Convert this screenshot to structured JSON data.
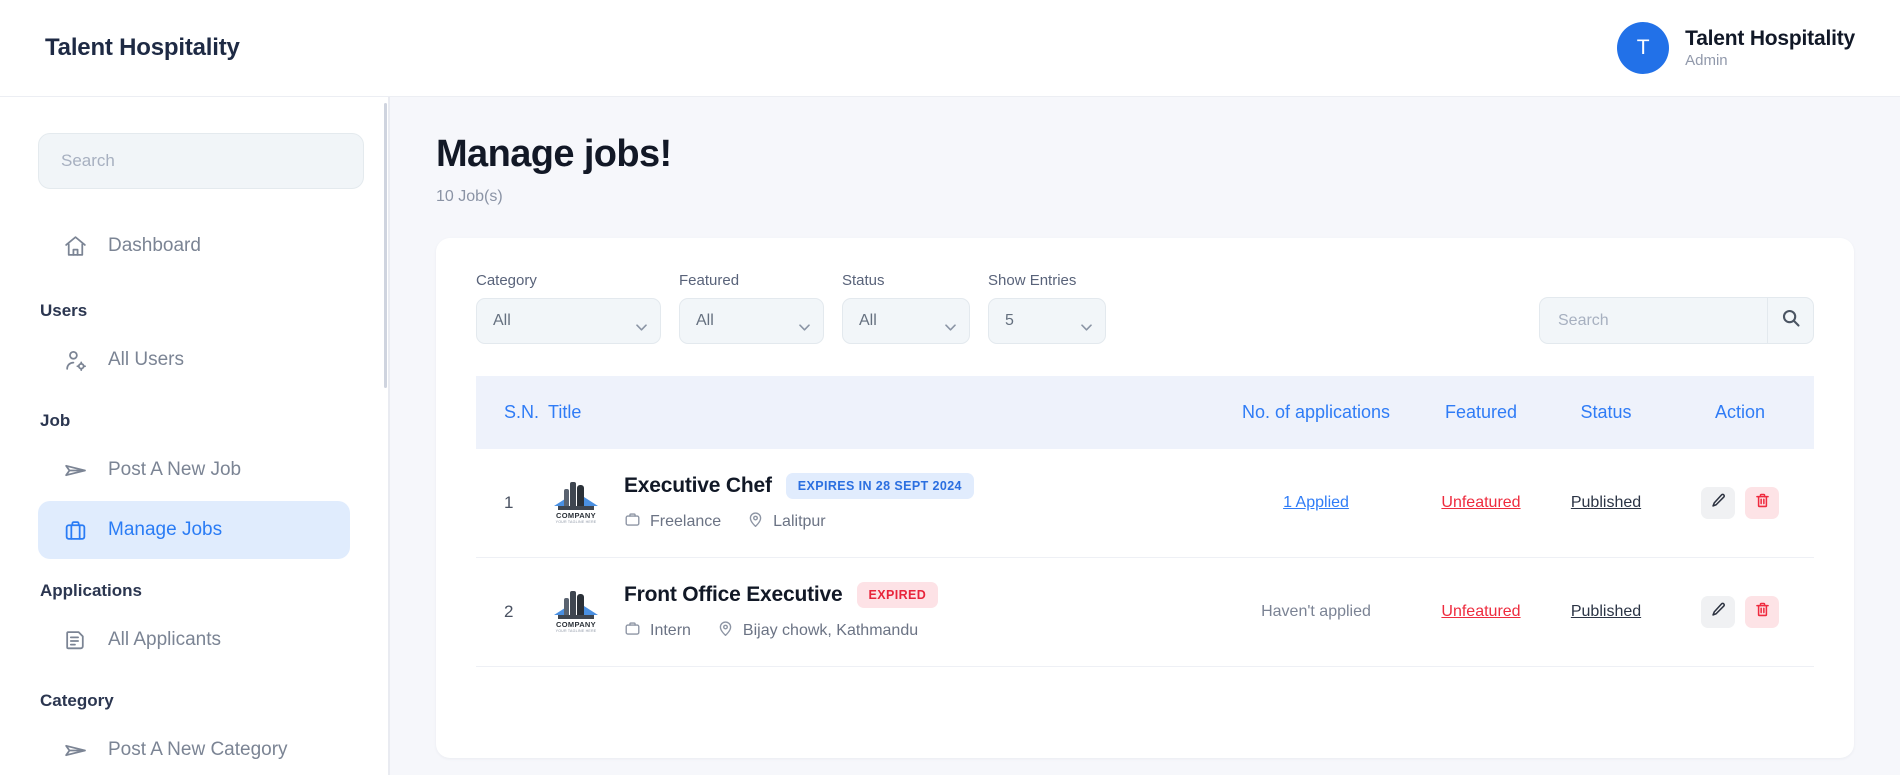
{
  "topbar": {
    "brand": "Talent Hospitality",
    "avatar_initial": "T",
    "user_name": "Talent Hospitality",
    "user_role": "Admin",
    "accent_color": "#2271e8"
  },
  "sidebar": {
    "search_placeholder": "Search",
    "search_value": "",
    "groups": [
      {
        "title": "",
        "items": [
          {
            "label": "Dashboard",
            "icon": "home-icon",
            "active": false
          }
        ]
      },
      {
        "title": "Users",
        "items": [
          {
            "label": "All Users",
            "icon": "user-gear-icon",
            "active": false
          }
        ]
      },
      {
        "title": "Job",
        "items": [
          {
            "label": "Post A New Job",
            "icon": "send-icon",
            "active": false
          },
          {
            "label": "Manage Jobs",
            "icon": "briefcase-icon",
            "active": true
          }
        ]
      },
      {
        "title": "Applications",
        "items": [
          {
            "label": "All Applicants",
            "icon": "document-list-icon",
            "active": false
          }
        ]
      },
      {
        "title": "Category",
        "items": [
          {
            "label": "Post A New Category",
            "icon": "send-icon",
            "active": false
          }
        ]
      }
    ]
  },
  "main": {
    "page_title": "Manage jobs!",
    "page_subtitle": "10 Job(s)",
    "filters": [
      {
        "label": "Category",
        "value": "All"
      },
      {
        "label": "Featured",
        "value": "All"
      },
      {
        "label": "Status",
        "value": "All"
      },
      {
        "label": "Show Entries",
        "value": "5"
      }
    ],
    "table_search_placeholder": "Search",
    "table_search_value": "",
    "table": {
      "headers": {
        "sn": "S.N.",
        "title": "Title",
        "applications": "No. of applications",
        "featured": "Featured",
        "status": "Status",
        "action": "Action"
      },
      "header_color": "#2f7cf6",
      "rows": [
        {
          "sn": "1",
          "company_logo_name": "COMPANY",
          "company_logo_tagline": "YOUR TAGLINE HERE",
          "job_title": "Executive Chef",
          "badge_text": "EXPIRES IN 28 SEPT 2024",
          "badge_type": "blue",
          "job_type": "Freelance",
          "location": "Lalitpur",
          "applications": "1 Applied",
          "applications_is_link": true,
          "featured": "Unfeatured",
          "status": "Published"
        },
        {
          "sn": "2",
          "company_logo_name": "COMPANY",
          "company_logo_tagline": "YOUR TAGLINE HERE",
          "job_title": "Front Office Executive",
          "badge_text": "EXPIRED",
          "badge_type": "red",
          "job_type": "Intern",
          "location": "Bijay chowk, Kathmandu",
          "applications": "Haven't applied",
          "applications_is_link": false,
          "featured": "Unfeatured",
          "status": "Published"
        }
      ]
    }
  }
}
